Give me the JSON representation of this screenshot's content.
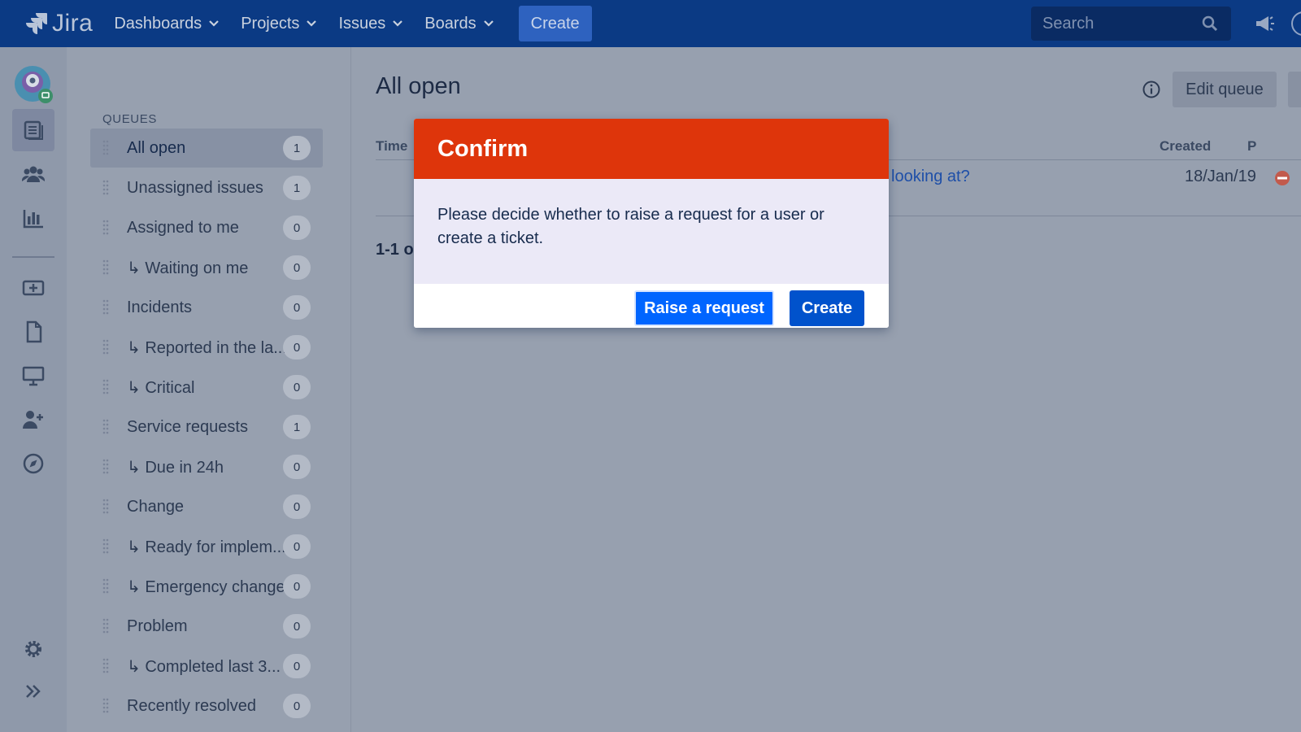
{
  "topnav": {
    "logo_text": "Jira",
    "items": [
      {
        "label": "Dashboards"
      },
      {
        "label": "Projects"
      },
      {
        "label": "Issues"
      },
      {
        "label": "Boards"
      }
    ],
    "create_label": "Create",
    "search_placeholder": "Search"
  },
  "sidebar": {
    "title": "QUEUES",
    "queues": [
      {
        "label": "All open",
        "count": "1",
        "active": true
      },
      {
        "label": "Unassigned issues",
        "count": "1"
      },
      {
        "label": "Assigned to me",
        "count": "0"
      },
      {
        "label": "↳ Waiting on me",
        "count": "0"
      },
      {
        "label": "Incidents",
        "count": "0"
      },
      {
        "label": "↳ Reported in the la...",
        "count": "0"
      },
      {
        "label": "↳ Critical",
        "count": "0"
      },
      {
        "label": "Service requests",
        "count": "1"
      },
      {
        "label": "↳ Due in 24h",
        "count": "0"
      },
      {
        "label": "Change",
        "count": "0"
      },
      {
        "label": "↳ Ready for implem...",
        "count": "0"
      },
      {
        "label": "↳ Emergency change",
        "count": "0"
      },
      {
        "label": "Problem",
        "count": "0"
      },
      {
        "label": "↳ Completed last 3...",
        "count": "0"
      },
      {
        "label": "Recently resolved",
        "count": "0"
      }
    ]
  },
  "main": {
    "title": "All open",
    "edit_queue_label": "Edit queue",
    "columns": {
      "time": "Time",
      "created": "Created",
      "priority": "P"
    },
    "row": {
      "summary": "looking at?",
      "created": "18/Jan/19"
    },
    "pager": "1-1 o"
  },
  "modal": {
    "title": "Confirm",
    "body": "Please decide whether to raise a request for a user or create a ticket.",
    "raise_label": "Raise a request",
    "create_label": "Create"
  },
  "colors": {
    "nav_bg": "#0b3a84",
    "modal_header": "#de350b",
    "primary_button": "#0052cc"
  }
}
